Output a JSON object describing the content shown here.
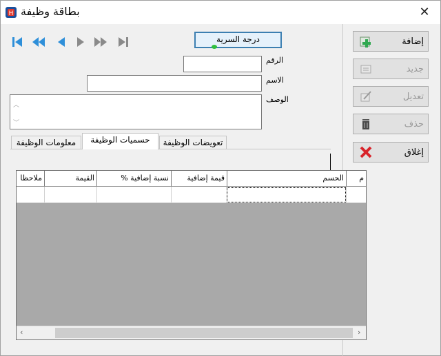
{
  "window": {
    "title": "بطاقة وظيفة",
    "close_glyph": "✕"
  },
  "toolbar": {
    "grade_button": "درجة السرية"
  },
  "navigation": {
    "first": "first-record",
    "previous_page": "previous-page",
    "previous": "previous-record",
    "next": "next-record",
    "next_page": "next-page",
    "last": "last-record"
  },
  "form": {
    "number_label": "الرقم",
    "number_value": "",
    "name_label": "الاسم",
    "name_value": "",
    "description_label": "الوصف",
    "description_value": ""
  },
  "side_buttons": [
    {
      "label": "إضافة",
      "enabled": true,
      "icon": "add-icon"
    },
    {
      "label": "جديد",
      "enabled": false,
      "icon": "new-icon"
    },
    {
      "label": "تعديل",
      "enabled": false,
      "icon": "edit-icon"
    },
    {
      "label": "حذف",
      "enabled": false,
      "icon": "delete-icon"
    },
    {
      "label": "إغلاق",
      "enabled": true,
      "icon": "close-icon"
    }
  ],
  "tabs": [
    {
      "label": "معلومات الوظيفة",
      "active": false
    },
    {
      "label": "حسميات الوظيفة",
      "active": true
    },
    {
      "label": "تعويضات الوظيفة",
      "active": false
    }
  ],
  "grid": {
    "columns": [
      "م",
      "الحسم",
      "قيمة إضافية",
      "نسبة إضافية %",
      "القيمة",
      "ملاحظا"
    ],
    "rows": [
      [
        "",
        "",
        "",
        "",
        "",
        ""
      ]
    ],
    "scroll_left": "‹",
    "scroll_right": "›"
  },
  "colors": {
    "accent": "#3c7fb1",
    "add_green": "#2fa84f",
    "close_red": "#d8232a"
  }
}
